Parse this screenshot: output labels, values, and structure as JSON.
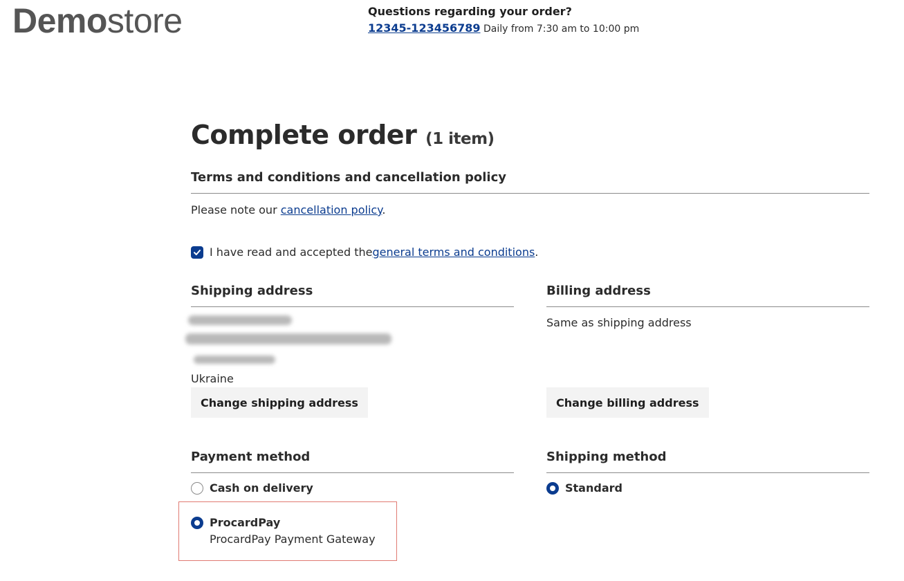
{
  "header": {
    "logo_bold": "Demo",
    "logo_light": "store",
    "help_title": "Questions regarding your order?",
    "help_phone": "12345-123456789",
    "help_hours": "Daily from 7:30 am to 10:00 pm"
  },
  "order": {
    "title": "Complete order",
    "item_count": "(1 item)"
  },
  "terms": {
    "title": "Terms and conditions and cancellation policy",
    "note_prefix": "Please note our ",
    "note_link": "cancellation policy",
    "note_suffix": ".",
    "accept_prefix": "I have read and accepted the ",
    "accept_link": "general terms and conditions",
    "accept_suffix": ".",
    "accepted": true
  },
  "shipping_address": {
    "title": "Shipping address",
    "country": "Ukraine",
    "change_button": "Change shipping address"
  },
  "billing_address": {
    "title": "Billing address",
    "text": "Same as shipping address",
    "change_button": "Change billing address"
  },
  "payment": {
    "title": "Payment method",
    "options": [
      {
        "label": "Cash on delivery",
        "selected": false
      },
      {
        "label": "ProcardPay",
        "description": "ProcardPay Payment Gateway",
        "selected": true
      }
    ]
  },
  "shipping_method": {
    "title": "Shipping method",
    "options": [
      {
        "label": "Standard",
        "selected": true
      }
    ]
  },
  "colors": {
    "accent": "#0b3c8f",
    "highlight_border": "#e07a72",
    "button_bg": "#f3f3f3"
  }
}
